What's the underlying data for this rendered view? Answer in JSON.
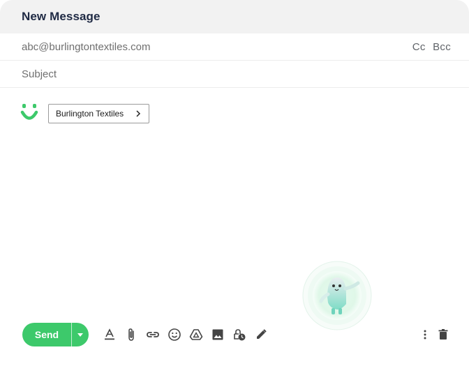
{
  "compose": {
    "title": "New Message",
    "to_value": "abc@burlingtontextiles.com",
    "cc_label": "Cc",
    "bcc_label": "Bcc",
    "subject_placeholder": "Subject"
  },
  "body": {
    "chip_label": "Burlington Textiles",
    "brand_color": "#3dc96b"
  },
  "toolbar": {
    "send_label": "Send",
    "icons": [
      "format-text-icon",
      "attach-icon",
      "link-icon",
      "emoji-icon",
      "drive-icon",
      "image-icon",
      "confidential-icon",
      "signature-icon",
      "more-options-icon",
      "trash-icon"
    ]
  }
}
